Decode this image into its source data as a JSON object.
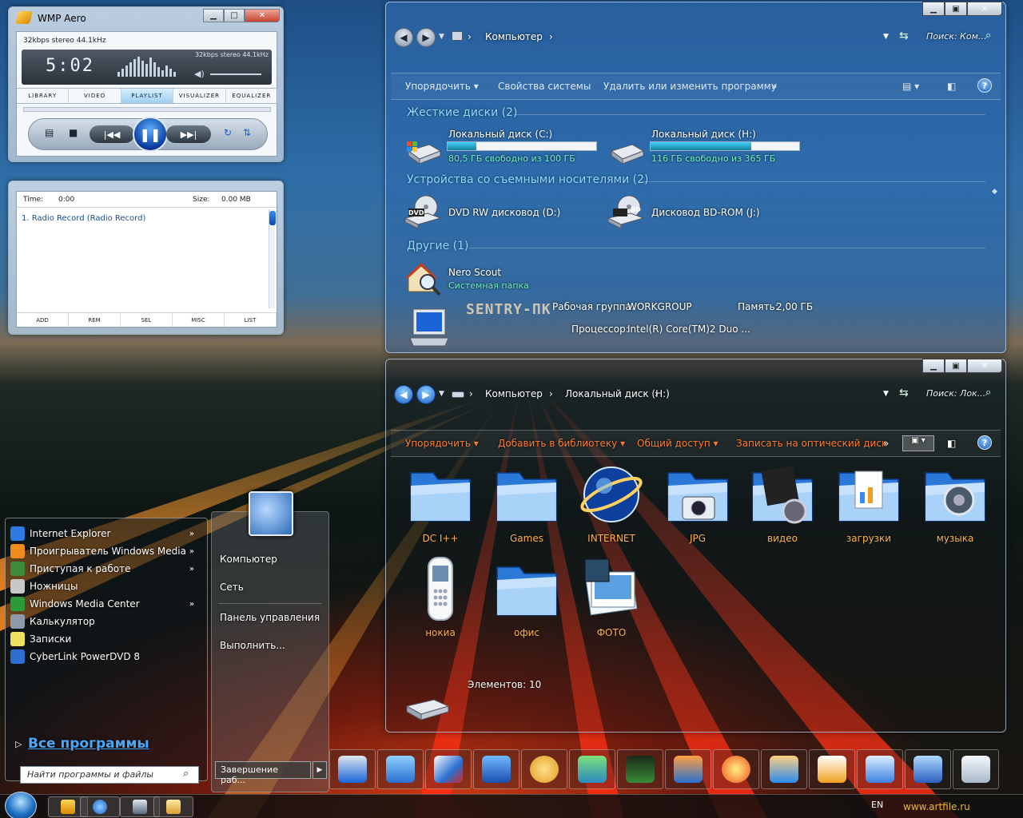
{
  "wmp": {
    "title": "WMP Aero",
    "info_line": "32kbps stereo 44.1kHz",
    "screen_info": "32kbps stereo 44.1kHz",
    "time": "5:02",
    "tabs": [
      "LIBRARY",
      "VIDEO",
      "PLAYLIST",
      "VISUALIZER",
      "EQUALIZER"
    ],
    "active_tab": "PLAYLIST"
  },
  "playlist": {
    "time_label": "Time:",
    "time_value": "0:00",
    "size_label": "Size:",
    "size_value": "0.00 MB",
    "items": [
      "1. Radio Record  (Radio Record)"
    ],
    "footer": [
      "ADD",
      "REM",
      "SEL",
      "MISC",
      "LIST"
    ]
  },
  "explorer_computer": {
    "breadcrumb": [
      "Компьютер"
    ],
    "search_placeholder": "Поиск: Ком...",
    "toolbar": [
      "Упорядочить",
      "Свойства системы",
      "Удалить или изменить программу"
    ],
    "more": "»",
    "groups": {
      "hard_disks": "Жесткие диски (2)",
      "removable": "Устройства со съемными носителями (2)",
      "other": "Другие (1)"
    },
    "drives": [
      {
        "name": "Локальный диск (C:)",
        "free": "80,5 ГБ свободно из 100 ГБ",
        "used_fraction": 0.195
      },
      {
        "name": "Локальный диск (H:)",
        "free": "116 ГБ свободно из 365 ГБ",
        "used_fraction": 0.68
      }
    ],
    "removable": [
      {
        "name": "DVD RW дисковод (D:)",
        "badge": "DVD"
      },
      {
        "name": "Дисковод BD-ROM (J:)",
        "badge": "BD"
      }
    ],
    "other": {
      "name": "Nero Scout",
      "type": "Системная папка"
    },
    "details": {
      "computer_name": "SENTRY-ПК",
      "workgroup_label": "Рабочая группа:",
      "workgroup_value": "WORKGROUP",
      "memory_label": "Память:",
      "memory_value": "2,00 ГБ",
      "cpu_label": "Процессор:",
      "cpu_value": "Intel(R) Core(TM)2 Duo ..."
    }
  },
  "explorer_disk": {
    "breadcrumb": [
      "Компьютер",
      "Локальный диск (H:)"
    ],
    "search_placeholder": "Поиск: Лок...",
    "toolbar": [
      "Упорядочить",
      "Добавить в библиотеку",
      "Общий доступ",
      "Записать на оптический диск"
    ],
    "more": "»",
    "items": [
      {
        "label": "DC I++",
        "icon": "folder-icon"
      },
      {
        "label": "Games",
        "icon": "folder-icon"
      },
      {
        "label": "INTERNET",
        "icon": "globe-icon"
      },
      {
        "label": "JPG",
        "icon": "camera-folder-icon"
      },
      {
        "label": "видео",
        "icon": "film-folder-icon"
      },
      {
        "label": "загрузки",
        "icon": "downloads-folder-icon"
      },
      {
        "label": "музыка",
        "icon": "music-folder-icon"
      },
      {
        "label": "нокиа",
        "icon": "phone-icon"
      },
      {
        "label": "офис",
        "icon": "folder-icon"
      },
      {
        "label": "ФОТО",
        "icon": "photo-folder-icon"
      }
    ],
    "status": "Элементов: 10"
  },
  "start_menu": {
    "programs": [
      {
        "label": "Internet Explorer",
        "arrow": true,
        "color": "#2b7be0"
      },
      {
        "label": "Проигрыватель Windows Media",
        "arrow": true,
        "color": "#f08a1c"
      },
      {
        "label": "Приступая к работе",
        "arrow": true,
        "color": "#3a8c3a"
      },
      {
        "label": "Ножницы",
        "arrow": false,
        "color": "#c8c8c8"
      },
      {
        "label": "Windows Media Center",
        "arrow": true,
        "color": "#2c9a3a"
      },
      {
        "label": "Калькулятор",
        "arrow": false,
        "color": "#8c9aa8"
      },
      {
        "label": "Записки",
        "arrow": false,
        "color": "#f0e060"
      },
      {
        "label": "CyberLink PowerDVD 8",
        "arrow": false,
        "color": "#2d6fd0"
      }
    ],
    "all_programs": "Все программы",
    "search_placeholder": "Найти программы и файлы",
    "right_items": [
      "Компьютер",
      "Сеть",
      "Панель управления",
      "Выполнить..."
    ],
    "shutdown": "Завершение раб..."
  },
  "taskbar": {
    "language": "EN",
    "watermark": "www.artfile.ru"
  }
}
